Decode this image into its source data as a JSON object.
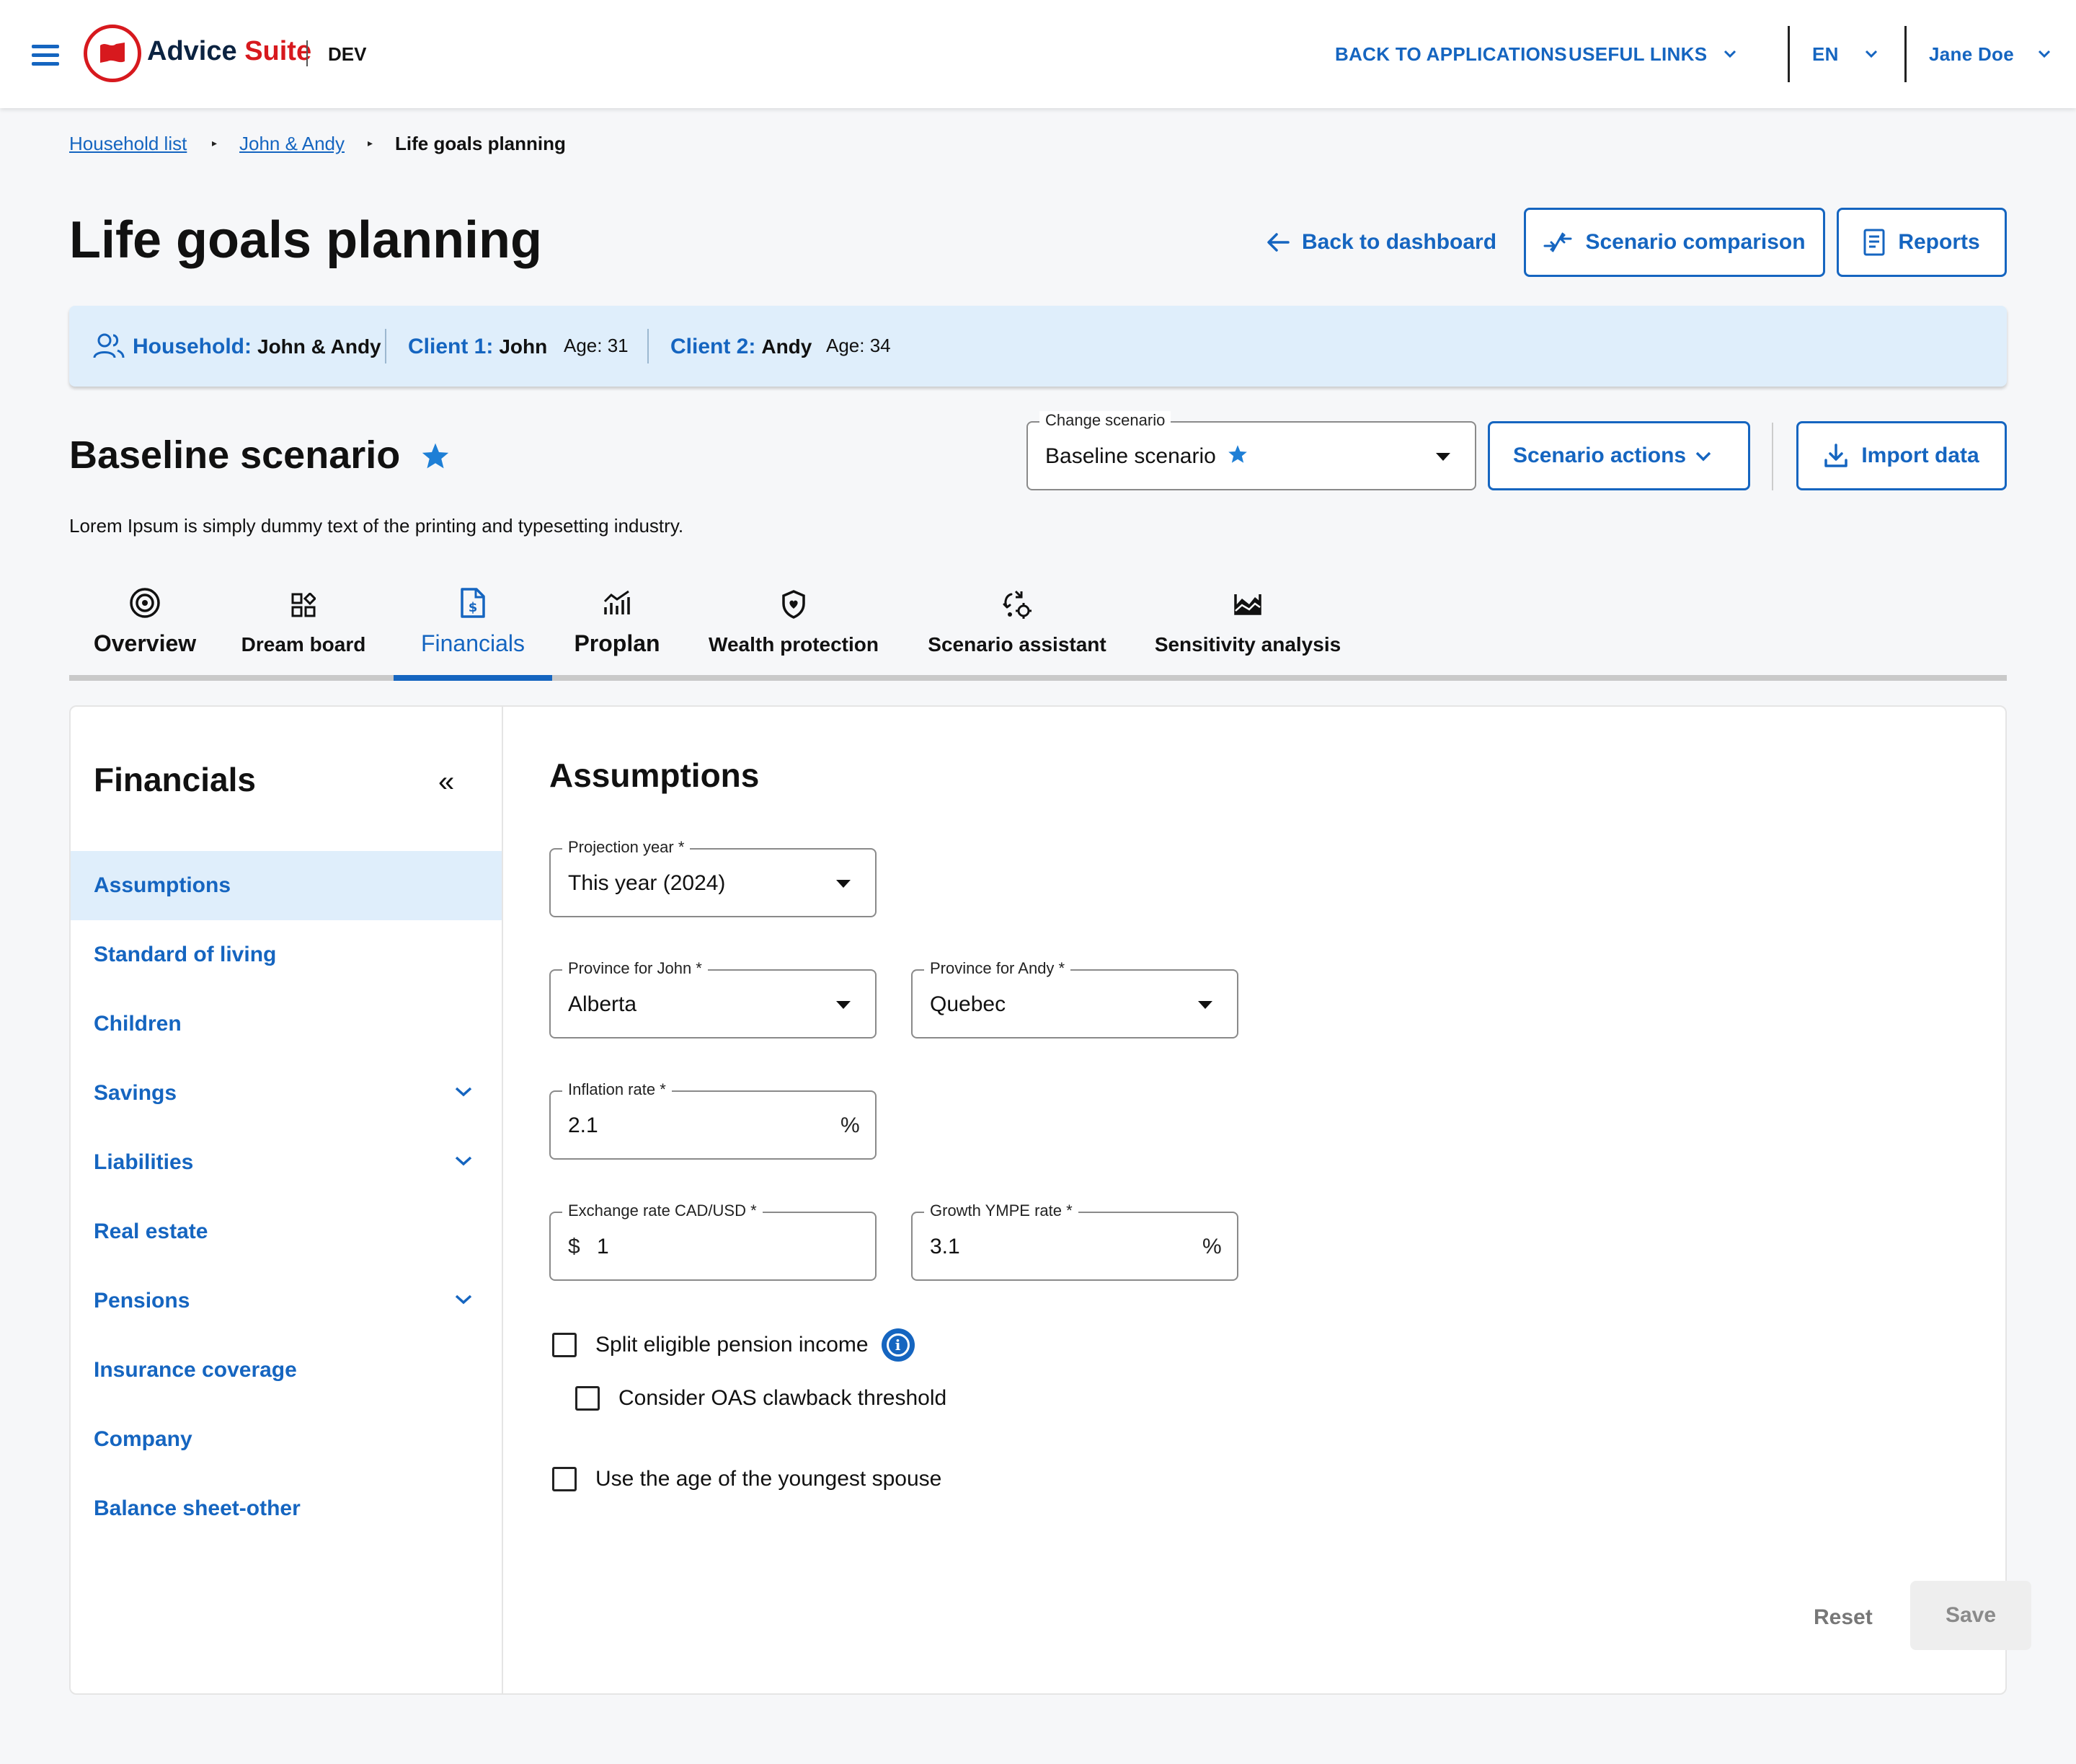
{
  "header": {
    "brand_part1": "Advice",
    "brand_part2": "Suite",
    "env": "DEV",
    "back_to_apps": "BACK TO APPLICATIONS",
    "useful_links": "USEFUL LINKS",
    "language": "EN",
    "user": "Jane Doe"
  },
  "breadcrumb": [
    "Household list",
    "John & Andy",
    "Life goals planning"
  ],
  "page_title": "Life goals planning",
  "actions": {
    "back_to_dashboard": "Back to dashboard",
    "scenario_comparison": "Scenario comparison",
    "reports": "Reports"
  },
  "household": {
    "label": "Household:",
    "name": "John & Andy",
    "client1_label": "Client 1:",
    "client1_name": "John",
    "client1_age": "Age: 31",
    "client2_label": "Client 2:",
    "client2_name": "Andy",
    "client2_age": "Age: 34"
  },
  "scenario": {
    "title": "Baseline scenario",
    "description": "Lorem Ipsum is simply dummy text of the printing and typesetting industry.",
    "change_label": "Change scenario",
    "change_value": "Baseline scenario",
    "actions_label": "Scenario actions",
    "import_label": "Import data"
  },
  "tabs": [
    {
      "label": "Overview"
    },
    {
      "label": "Dream board"
    },
    {
      "label": "Financials"
    },
    {
      "label": "Proplan"
    },
    {
      "label": "Wealth protection"
    },
    {
      "label": "Scenario assistant"
    },
    {
      "label": "Sensitivity analysis"
    }
  ],
  "active_tab": "Financials",
  "sidebar": {
    "title": "Financials",
    "items": [
      {
        "label": "Assumptions"
      },
      {
        "label": "Standard of living"
      },
      {
        "label": "Children"
      },
      {
        "label": "Savings"
      },
      {
        "label": "Liabilities"
      },
      {
        "label": "Real estate"
      },
      {
        "label": "Pensions"
      },
      {
        "label": "Insurance coverage"
      },
      {
        "label": "Company"
      },
      {
        "label": "Balance sheet-other"
      }
    ]
  },
  "form": {
    "title": "Assumptions",
    "projection_year": {
      "label": "Projection year *",
      "value": "This year (2024)"
    },
    "province_john": {
      "label": "Province for John *",
      "value": "Alberta"
    },
    "province_andy": {
      "label": "Province for Andy *",
      "value": "Quebec"
    },
    "inflation_rate": {
      "label": "Inflation rate *",
      "value": "2.1",
      "unit": "%"
    },
    "exchange_rate": {
      "label": "Exchange rate CAD/USD *",
      "prefix": "$",
      "value": "1"
    },
    "growth_ympe": {
      "label": "Growth YMPE rate *",
      "value": "3.1",
      "unit": "%"
    },
    "split_pension": "Split eligible pension income",
    "oas_clawback": "Consider OAS clawback threshold",
    "youngest_spouse": "Use the age of the youngest spouse",
    "info_glyph": "i",
    "reset": "Reset",
    "save": "Save"
  },
  "colors": {
    "primary": "#1565c0",
    "brand_red": "#d7191e",
    "brand_navy": "#0b2341",
    "banner_bg": "#dfeefb"
  }
}
